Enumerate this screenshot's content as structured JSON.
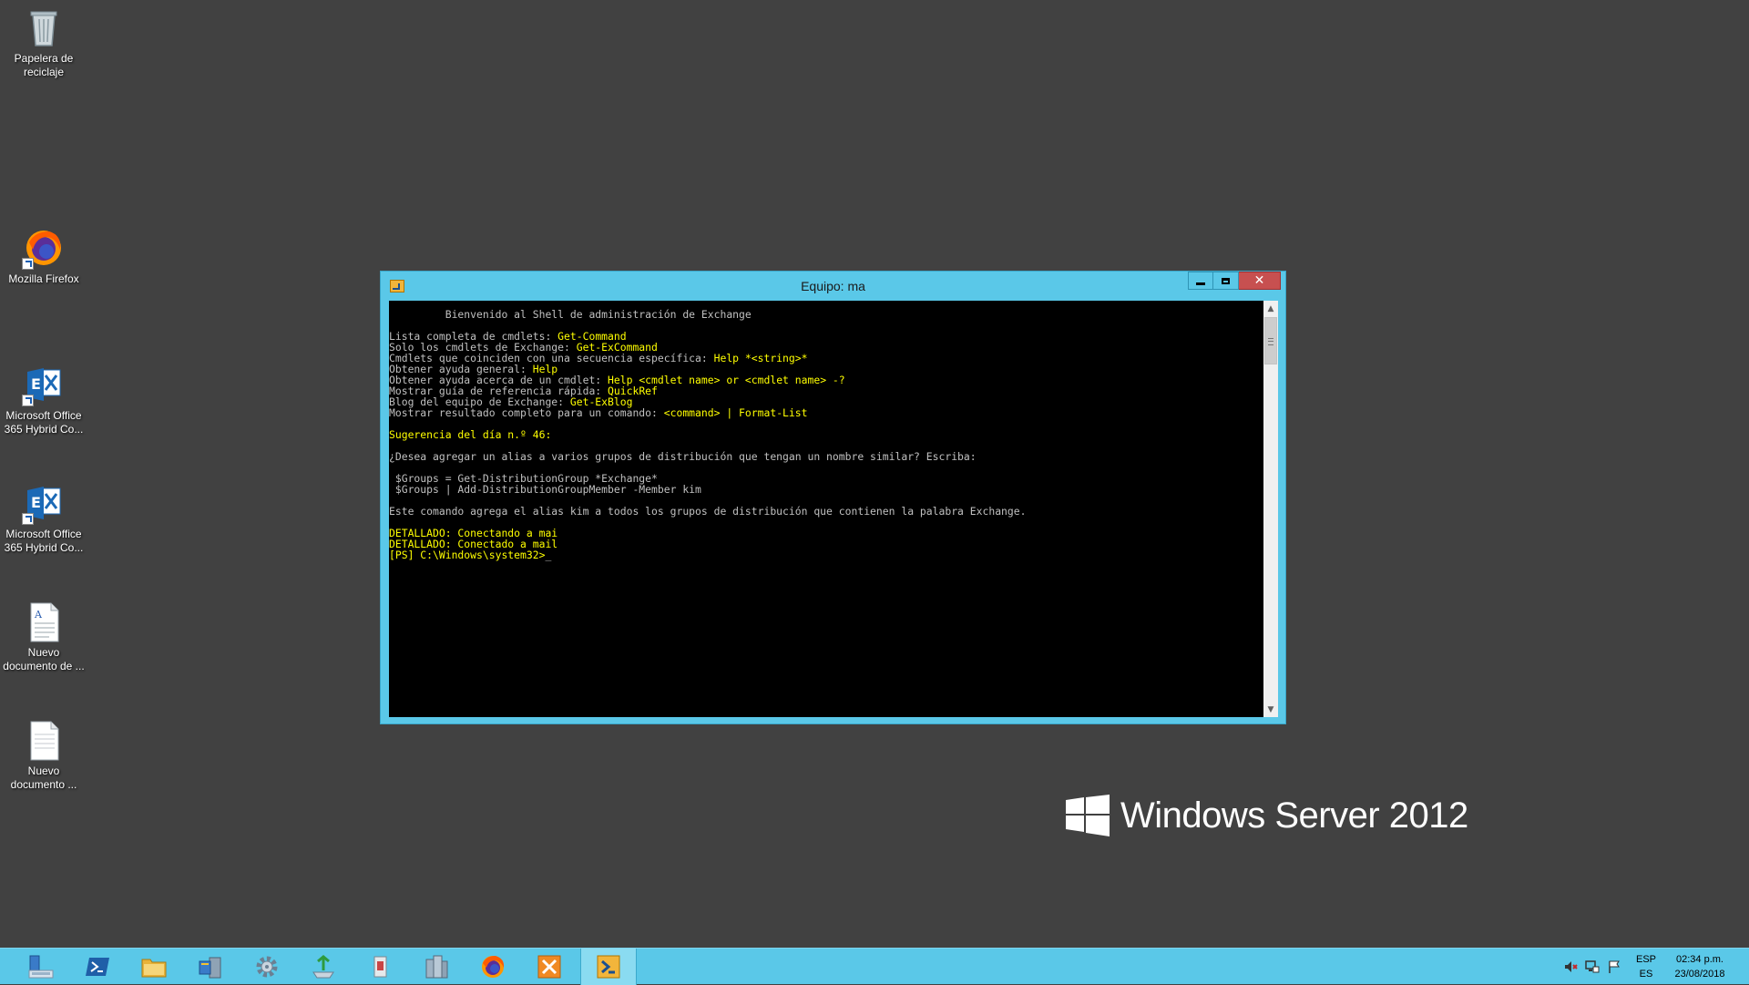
{
  "desktop": {
    "icons": [
      {
        "label": "Papelera de\nreciclaje",
        "icon": "recycle-bin-icon"
      },
      {
        "label": "Mozilla Firefox",
        "icon": "firefox-icon"
      },
      {
        "label": "Microsoft Office\n365 Hybrid Co...",
        "icon": "exchange-icon"
      },
      {
        "label": "Microsoft Office\n365 Hybrid Co...",
        "icon": "exchange-icon"
      },
      {
        "label": "Nuevo\ndocumento de ...",
        "icon": "document-icon"
      },
      {
        "label": "Nuevo\ndocumento ...",
        "icon": "text-document-icon"
      }
    ],
    "branding": "Windows Server 2012"
  },
  "window": {
    "title": "Equipo: ma",
    "close_label": "✕",
    "console_lines": [
      [
        {
          "t": "         Bienvenido al Shell de administración de Exchange",
          "c": "w"
        }
      ],
      [],
      [
        {
          "t": "Lista completa de cmdlets: ",
          "c": "w"
        },
        {
          "t": "Get-Command",
          "c": "y"
        }
      ],
      [
        {
          "t": "Solo los cmdlets de Exchange: ",
          "c": "w"
        },
        {
          "t": "Get-ExCommand",
          "c": "y"
        }
      ],
      [
        {
          "t": "Cmdlets que coinciden con una secuencia específica: ",
          "c": "w"
        },
        {
          "t": "Help *<string>*",
          "c": "y"
        }
      ],
      [
        {
          "t": "Obtener ayuda general: ",
          "c": "w"
        },
        {
          "t": "Help",
          "c": "y"
        }
      ],
      [
        {
          "t": "Obtener ayuda acerca de un cmdlet: ",
          "c": "w"
        },
        {
          "t": "Help <cmdlet name> or <cmdlet name> -?",
          "c": "y"
        }
      ],
      [
        {
          "t": "Mostrar guía de referencia rápida: ",
          "c": "w"
        },
        {
          "t": "QuickRef",
          "c": "y"
        }
      ],
      [
        {
          "t": "Blog del equipo de Exchange: ",
          "c": "w"
        },
        {
          "t": "Get-ExBlog",
          "c": "y"
        }
      ],
      [
        {
          "t": "Mostrar resultado completo para un comando: ",
          "c": "w"
        },
        {
          "t": "<command> | Format-List",
          "c": "y"
        }
      ],
      [],
      [
        {
          "t": "Sugerencia del día n.º 46:",
          "c": "y"
        }
      ],
      [],
      [
        {
          "t": "¿Desea agregar un alias a varios grupos de distribución que tengan un nombre similar? Escriba:",
          "c": "w"
        }
      ],
      [],
      [
        {
          "t": " $Groups = Get-DistributionGroup *Exchange*",
          "c": "w"
        }
      ],
      [
        {
          "t": " $Groups | Add-DistributionGroupMember -Member kim",
          "c": "w"
        }
      ],
      [],
      [
        {
          "t": "Este comando agrega el alias kim a todos los grupos de distribución que contienen la palabra Exchange.",
          "c": "w"
        }
      ],
      [],
      [
        {
          "t": "DETALLADO: Conectando a mai",
          "c": "y"
        }
      ],
      [
        {
          "t": "DETALLADO: Conectado a mail",
          "c": "y"
        }
      ],
      [
        {
          "t": "[PS] C:\\Windows\\system32>",
          "c": "y"
        },
        {
          "t": "_",
          "c": "w"
        }
      ]
    ]
  },
  "taskbar": {
    "items": [
      {
        "name": "server-manager"
      },
      {
        "name": "powershell"
      },
      {
        "name": "file-explorer"
      },
      {
        "name": "server-tools"
      },
      {
        "name": "services-gear"
      },
      {
        "name": "network-tool"
      },
      {
        "name": "document-tool"
      },
      {
        "name": "servers-tool"
      },
      {
        "name": "firefox"
      },
      {
        "name": "hybrid-config"
      },
      {
        "name": "exchange-shell",
        "active": true
      }
    ],
    "lang_top": "ESP",
    "lang_bottom": "ES",
    "time": "02:34 p.m.",
    "date": "23/08/2018"
  }
}
